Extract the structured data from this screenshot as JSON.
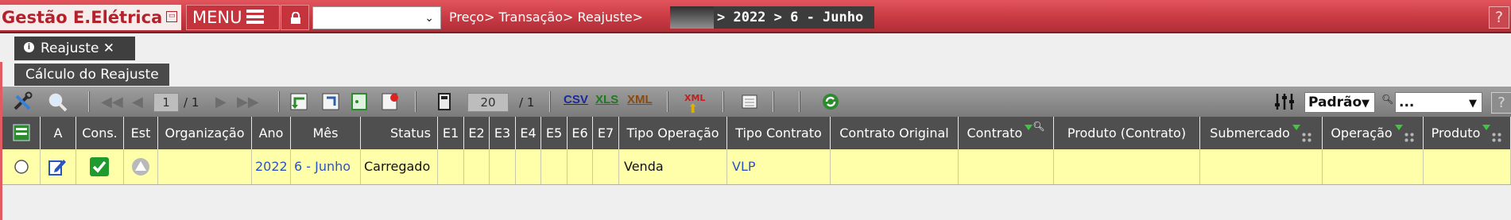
{
  "header": {
    "app_title": "Gestão E.Elétrica",
    "menu_label": "MENU",
    "breadcrumb": "Preço> Transação> Reajuste>",
    "breadcrumb_end": "> 2022 > 6 - Junho",
    "help": "?"
  },
  "tabs": [
    {
      "label": "Reajuste ✕"
    }
  ],
  "panel": {
    "title": "Cálculo do Reajuste"
  },
  "toolbar": {
    "page_current": "1",
    "page_total": "/ 1",
    "page_size": "20",
    "page_size_total": "/ 1",
    "csv": "CSV",
    "xls": "XLS",
    "xml": "XML",
    "xml_small": "XML",
    "view_select": "Padrão",
    "filter_select": "...",
    "help": "?"
  },
  "table": {
    "columns": [
      "",
      "A",
      "Cons.",
      "Est",
      "Organização",
      "Ano",
      "Mês",
      "Status",
      "E1",
      "E2",
      "E3",
      "E4",
      "E5",
      "E6",
      "E7",
      "Tipo Operação",
      "Tipo Contrato",
      "Contrato Original",
      "Contrato",
      "Produto (Contrato)",
      "Submercado",
      "Operação",
      "Produto"
    ],
    "rows": [
      {
        "organizacao": "",
        "ano": "2022",
        "mes": "6 - Junho",
        "status": "Carregado",
        "tipo_operacao": "Venda",
        "tipo_contrato": "VLP"
      }
    ]
  },
  "colors": {
    "brand_red": "#c93a43",
    "row_highlight": "#ffffaa",
    "header_dark": "#4f4f4f",
    "link_blue": "#2a54c2"
  }
}
